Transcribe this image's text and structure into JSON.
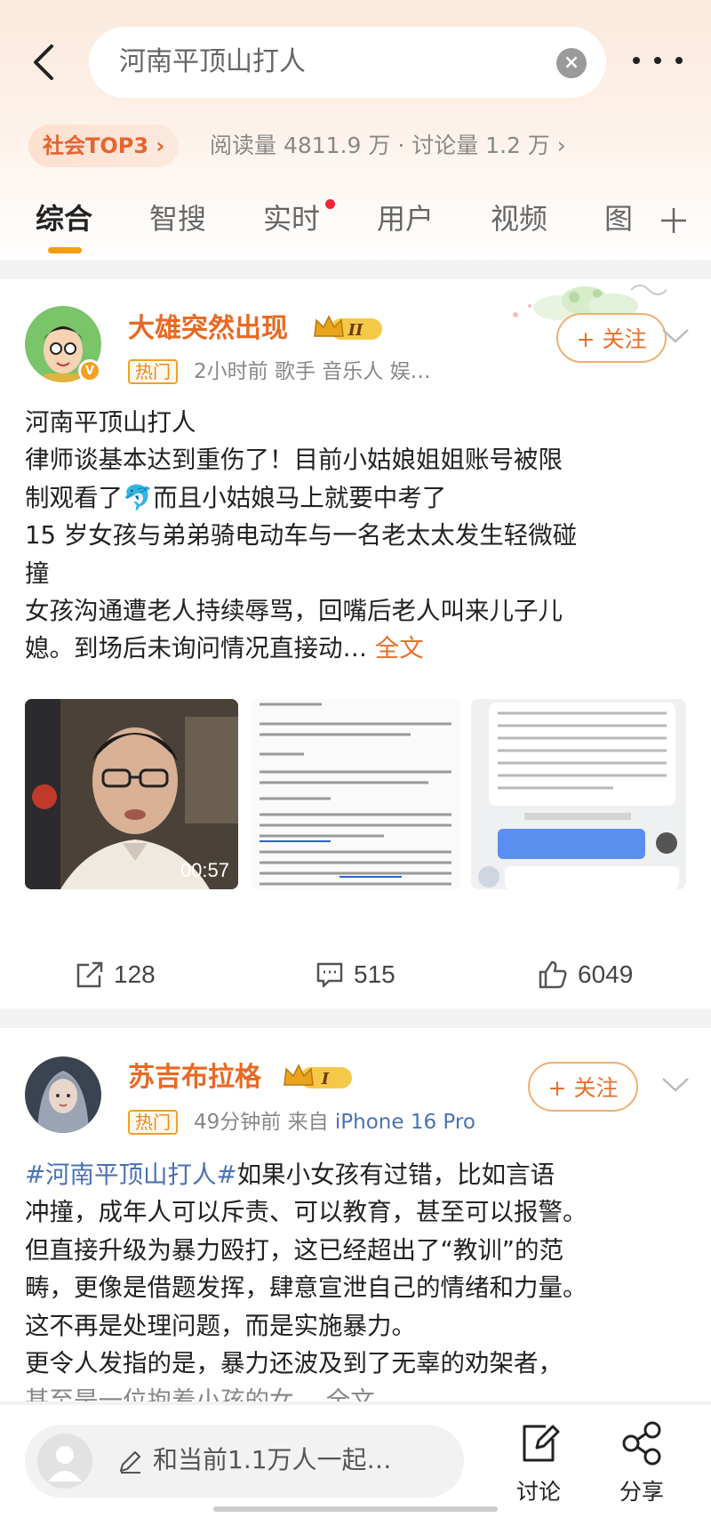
{
  "search": {
    "query": "河南平顶山打人"
  },
  "topic": {
    "rank_badge": "社会TOP3 ›",
    "stats": "阅读量 4811.9 万 · 讨论量 1.2 万 ›"
  },
  "tabs": [
    {
      "label": "综合"
    },
    {
      "label": "智搜"
    },
    {
      "label": "实时"
    },
    {
      "label": "用户"
    },
    {
      "label": "视频"
    },
    {
      "label": "图"
    }
  ],
  "posts": [
    {
      "username": "大雄突然出现",
      "vip_level": "II",
      "hot_tag": "热门",
      "meta": "2小时前  歌手 音乐人 娱…",
      "follow_label": "+ 关注",
      "lines": [
        "河南平顶山打人",
        "律师谈基本达到重伤了！目前小姑娘姐姐账号被限",
        "制观看了🐬而且小姑娘马上就要中考了",
        "15 岁女孩与弟弟骑电动车与一名老太太发生轻微碰",
        "撞",
        "女孩沟通遭老人持续辱骂，回嘴后老人叫来儿子儿"
      ],
      "last_line": "媳。到场后未询问情况直接动…",
      "more_label": " 全文",
      "video_duration": "00:57",
      "shares": "128",
      "comments": "515",
      "likes": "6049"
    },
    {
      "username": "苏吉布拉格",
      "vip_level": "I",
      "hot_tag": "热门",
      "meta": "49分钟前  来自 ",
      "device": "iPhone 16 Pro",
      "follow_label": "+ 关注",
      "hashtag": "#河南平顶山打人#",
      "first_line_rest": "如果小女孩有过错，比如言语",
      "lines": [
        "冲撞，成年人可以斥责、可以教育，甚至可以报警。",
        "但直接升级为暴力殴打，这已经超出了“教训”的范",
        "畴，更像是借题发挥，肆意宣泄自己的情绪和力量。",
        "这不再是处理问题，而是实施暴力。",
        "更令人发指的是，暴力还波及到了无辜的劝架者，"
      ],
      "partial_line": "甚至是一位抱着小孩的女… 全文"
    }
  ],
  "bottom_bar": {
    "comment_placeholder": "和当前1.1万人一起…",
    "discuss_label": "讨论",
    "share_label": "分享"
  }
}
